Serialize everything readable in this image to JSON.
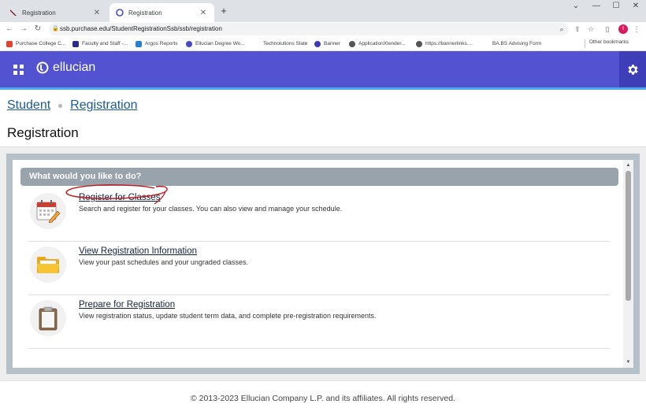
{
  "browser": {
    "tabs": [
      {
        "label": "Registration",
        "active": false
      },
      {
        "label": "Registration",
        "active": true
      }
    ],
    "new_tab": "+",
    "url": "ssb.purchase.edu/StudentRegistrationSsb/ssb/registration",
    "bookmarks": [
      {
        "label": "Purchase College C...",
        "color": "#e0452a"
      },
      {
        "label": "Faculty and Staff -...",
        "color": "#2b2b8c"
      },
      {
        "label": "Argos Reports",
        "color": "#2a7fd4"
      },
      {
        "label": "Ellucian Degree Wo...",
        "color": "#4a48c4"
      },
      {
        "label": "Technolutions Slate",
        "color": "#ffffff"
      },
      {
        "label": "Banner",
        "color": "#3c3cb0"
      },
      {
        "label": "ApplicationXtender...",
        "color": "#555555"
      },
      {
        "label": "https://bannerlinks....",
        "color": "#555555"
      },
      {
        "label": "BA.BS Advising Form",
        "color": "#ffffff"
      }
    ],
    "other_bookmarks": "Other bookmarks",
    "profile_initial": "I"
  },
  "header": {
    "brand": "ellucian",
    "background": "#5353d1",
    "accent_line": "#4ea9e8"
  },
  "breadcrumb": {
    "items": [
      "Student",
      "Registration"
    ]
  },
  "page": {
    "title": "Registration"
  },
  "panel": {
    "heading": "What would you like to do?",
    "items": [
      {
        "label": "Register for Classes",
        "description": "Search and register for your classes. You can also view and manage your schedule.",
        "icon": "calendar-pencil-icon"
      },
      {
        "label": "View Registration Information",
        "description": "View your past schedules and your ungraded classes.",
        "icon": "folder-icon"
      },
      {
        "label": "Prepare for Registration",
        "description": "View registration status, update student term data, and complete pre-registration requirements.",
        "icon": "clipboard-icon"
      }
    ]
  },
  "footer": {
    "text": "© 2013-2023 Ellucian Company L.P. and its affiliates. All rights reserved."
  }
}
